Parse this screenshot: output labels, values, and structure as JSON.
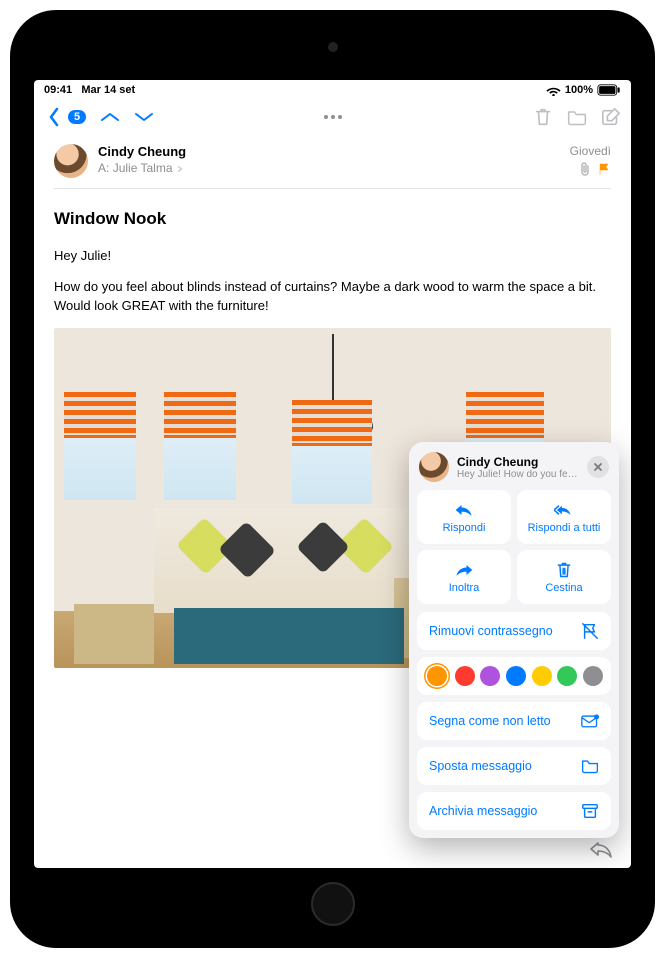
{
  "status": {
    "time": "09:41",
    "date": "Mar 14 set",
    "battery": "100%"
  },
  "nav": {
    "unread_count": "5"
  },
  "email": {
    "sender": "Cindy Cheung",
    "to_label": "A:",
    "recipient": "Julie Talma",
    "day": "Giovedì",
    "subject": "Window Nook",
    "greeting": "Hey Julie!",
    "body": "How do you feel about blinds instead of curtains? Maybe a dark wood to warm the space a bit. Would look GREAT with the furniture!"
  },
  "popover": {
    "sender": "Cindy Cheung",
    "preview": "Hey Julie! How do you feel ab...",
    "reply": "Rispondi",
    "reply_all": "Rispondi a tutti",
    "forward": "Inoltra",
    "trash": "Cestina",
    "unflag": "Rimuovi contrassegno",
    "mark_unread": "Segna come non letto",
    "move": "Sposta messaggio",
    "archive": "Archivia messaggio",
    "flag_colors": [
      "#ff9500",
      "#ff3b30",
      "#af52de",
      "#007aff",
      "#ffcc00",
      "#34c759",
      "#8e8e93"
    ]
  }
}
